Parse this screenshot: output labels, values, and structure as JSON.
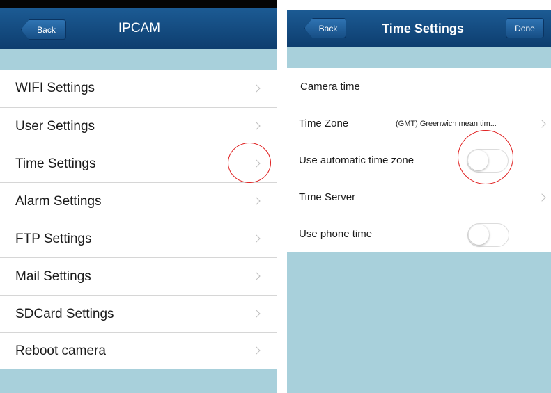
{
  "left_screen": {
    "back_label": "Back",
    "title": "IPCAM",
    "items": [
      {
        "label": "WIFI Settings"
      },
      {
        "label": "User Settings"
      },
      {
        "label": "Time Settings"
      },
      {
        "label": "Alarm Settings"
      },
      {
        "label": "FTP Settings"
      },
      {
        "label": "Mail Settings"
      },
      {
        "label": "SDCard Settings"
      },
      {
        "label": "Reboot camera"
      }
    ]
  },
  "right_screen": {
    "back_label": "Back",
    "title": "Time Settings",
    "done_label": "Done",
    "camera_time_label": "Camera time",
    "time_zone_label": "Time Zone",
    "time_zone_value": "(GMT) Greenwich mean tim...",
    "auto_time_zone_label": "Use automatic time zone",
    "auto_time_zone_on": false,
    "time_server_label": "Time Server",
    "phone_time_label": "Use phone time",
    "phone_time_on": false
  },
  "colors": {
    "nav_bar": "#164b80",
    "background_band": "#a8d0db",
    "highlight_circle": "#e02020"
  },
  "icons": [
    "chevron-right-icon"
  ]
}
